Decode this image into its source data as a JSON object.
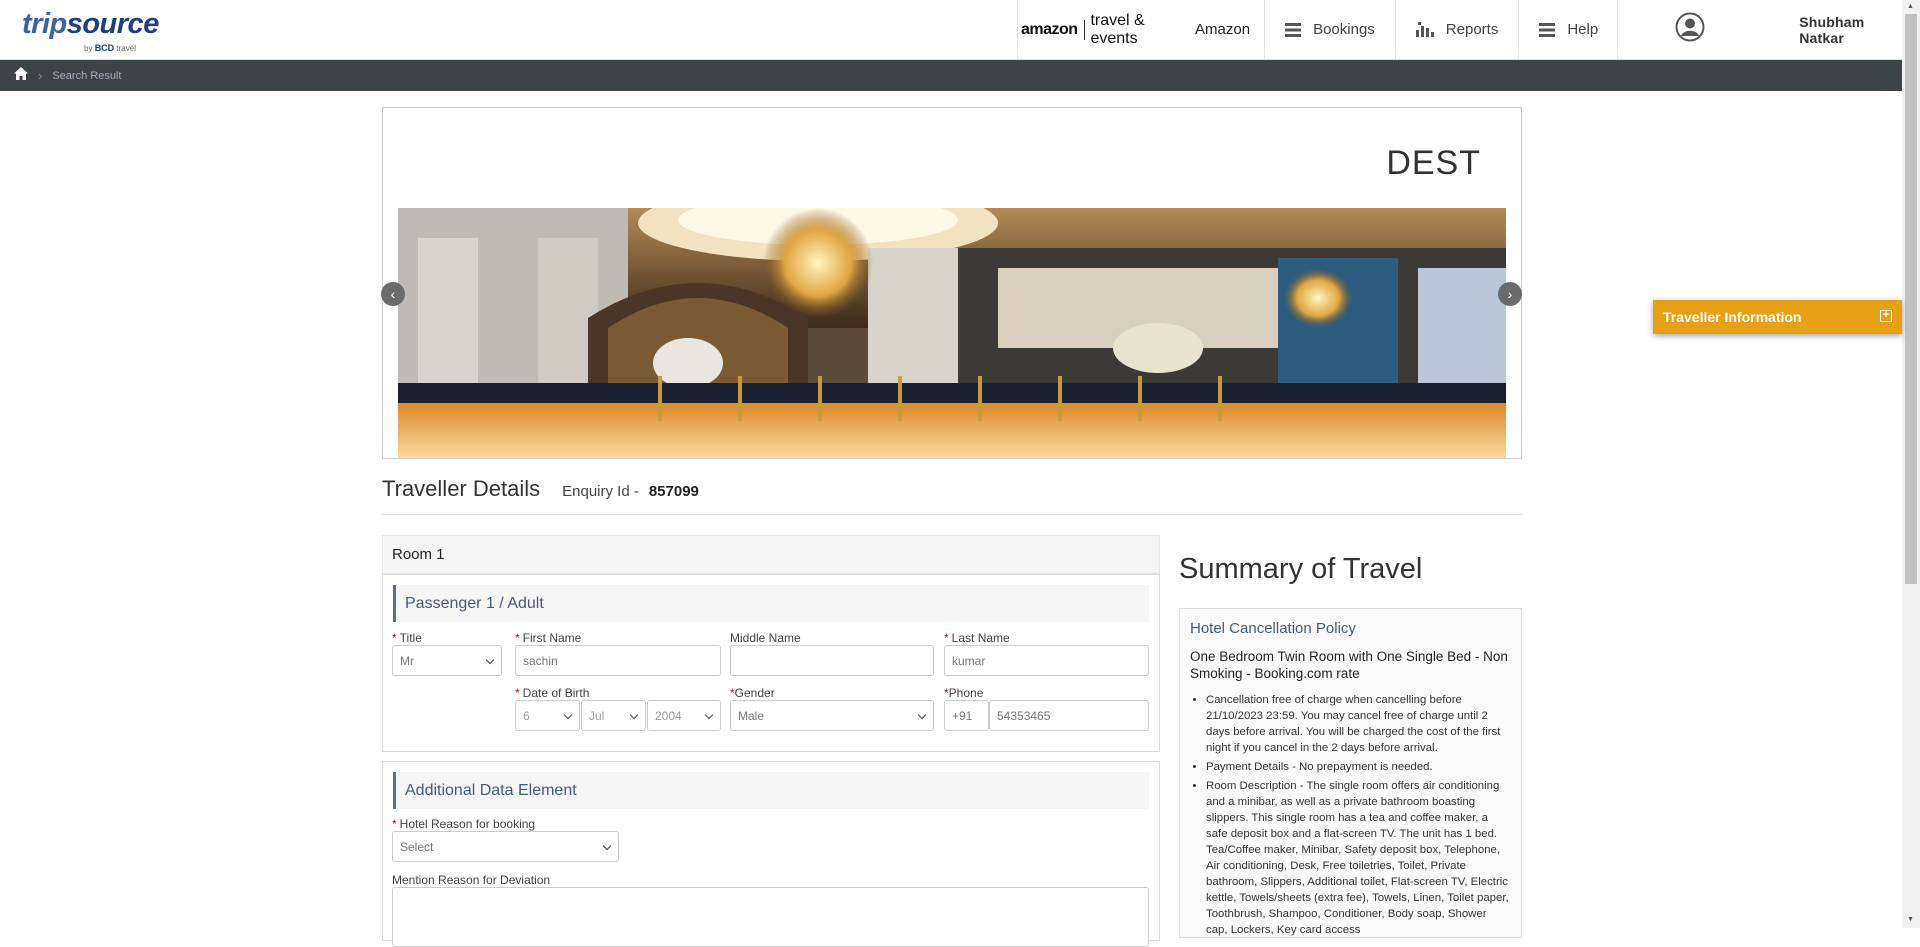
{
  "header": {
    "logo_main_a": "trip",
    "logo_main_b": "source",
    "logo_by": "by",
    "logo_bcd": "BCD",
    "logo_travel": "travel",
    "client_logo_left": "amazon",
    "client_logo_right": "travel & events",
    "client_name": "Amazon",
    "nav": [
      {
        "label": "Bookings",
        "icon": "list-icon"
      },
      {
        "label": "Reports",
        "icon": "bar-chart-icon"
      },
      {
        "label": "Help",
        "icon": "list-icon"
      }
    ],
    "user_name": "Shubham Natkar"
  },
  "breadcrumb": {
    "current": "Search Result"
  },
  "hero": {
    "destination": "DEST"
  },
  "traveller_info_tab": {
    "label": "Traveller Information",
    "accent": "#e6a117"
  },
  "traveller_details": {
    "title": "Traveller Details",
    "enquiry_label": "Enquiry Id -",
    "enquiry_id": "857099"
  },
  "room": {
    "label": "Room 1"
  },
  "passenger": {
    "heading": "Passenger 1 / Adult",
    "title_label": "Title",
    "title_value": "Mr",
    "first_name_label": "First Name",
    "first_name_value": "sachin",
    "middle_name_label": "Middle Name",
    "middle_name_value": "",
    "last_name_label": "Last Name",
    "last_name_value": "kumar",
    "dob_label": "Date of Birth",
    "dob_day": "6",
    "dob_month": "Jul",
    "dob_year": "2004",
    "gender_label": "Gender",
    "gender_value": "Male",
    "phone_label": "Phone",
    "phone_code": "+91",
    "phone_number": "54353465"
  },
  "additional": {
    "heading": "Additional Data Element",
    "reason_label": "Hotel Reason for booking",
    "reason_value": "Select",
    "deviation_label": "Mention Reason for Deviation"
  },
  "summary": {
    "title": "Summary of Travel",
    "policy_heading": "Hotel Cancellation Policy",
    "room_name": "One Bedroom Twin Room with One Single Bed - Non Smoking - Booking.com rate",
    "items": [
      "Cancellation free of charge when cancelling before 21/10/2023 23:59. You may cancel free of charge until 2 days before arrival. You will be charged the cost of the first night if you cancel in the 2 days before arrival.",
      "Payment Details - No prepayment is needed.",
      "Room Description - The single room offers air conditioning and a minibar, as well as a private bathroom boasting slippers. This single room has a tea and coffee maker, a safe deposit box and a flat-screen TV. The unit has 1 bed. Tea/Coffee maker, Minibar, Safety deposit box, Telephone, Air conditioning, Desk, Free toiletries, Toilet, Private bathroom, Slippers, Additional toilet, Flat-screen TV, Electric kettle, Towels/sheets (extra fee), Towels, Linen, Toilet paper, Toothbrush, Shampoo, Conditioner, Body soap, Shower cap, Lockers, Key card access"
    ]
  },
  "colors": {
    "breadcrumb_bg": "#3c4346",
    "heading_blue": "#435a86",
    "logo_blue": "#3a63a8"
  }
}
